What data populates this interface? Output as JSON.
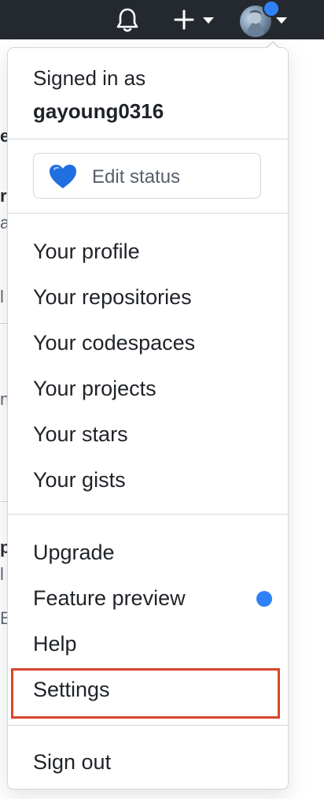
{
  "header": {
    "icons": [
      "bell-icon",
      "plus-icon",
      "chevron-down-icon",
      "avatar",
      "notification-dot"
    ]
  },
  "dropdown": {
    "signed_in_label": "Signed in as",
    "username": "gayoung0316",
    "status_button": {
      "icon": "blue-heart-emoji",
      "label": "Edit status"
    },
    "section_profile": [
      {
        "id": "your-profile",
        "label": "Your profile"
      },
      {
        "id": "your-repositories",
        "label": "Your repositories"
      },
      {
        "id": "your-codespaces",
        "label": "Your codespaces"
      },
      {
        "id": "your-projects",
        "label": "Your projects"
      },
      {
        "id": "your-stars",
        "label": "Your stars"
      },
      {
        "id": "your-gists",
        "label": "Your gists"
      }
    ],
    "section_account": [
      {
        "id": "upgrade",
        "label": "Upgrade"
      },
      {
        "id": "feature-preview",
        "label": "Feature preview",
        "badge_color": "#2f81f7"
      },
      {
        "id": "help",
        "label": "Help"
      },
      {
        "id": "settings",
        "label": "Settings",
        "highlighted": true
      }
    ],
    "sign_out_label": "Sign out"
  },
  "colors": {
    "header_bg": "#24292f",
    "accent_blue": "#2f81f7",
    "highlight_red": "#d9452a"
  },
  "background_fragments": [
    "e",
    "r",
    "a",
    "l",
    "n",
    "p",
    "l",
    "B"
  ]
}
